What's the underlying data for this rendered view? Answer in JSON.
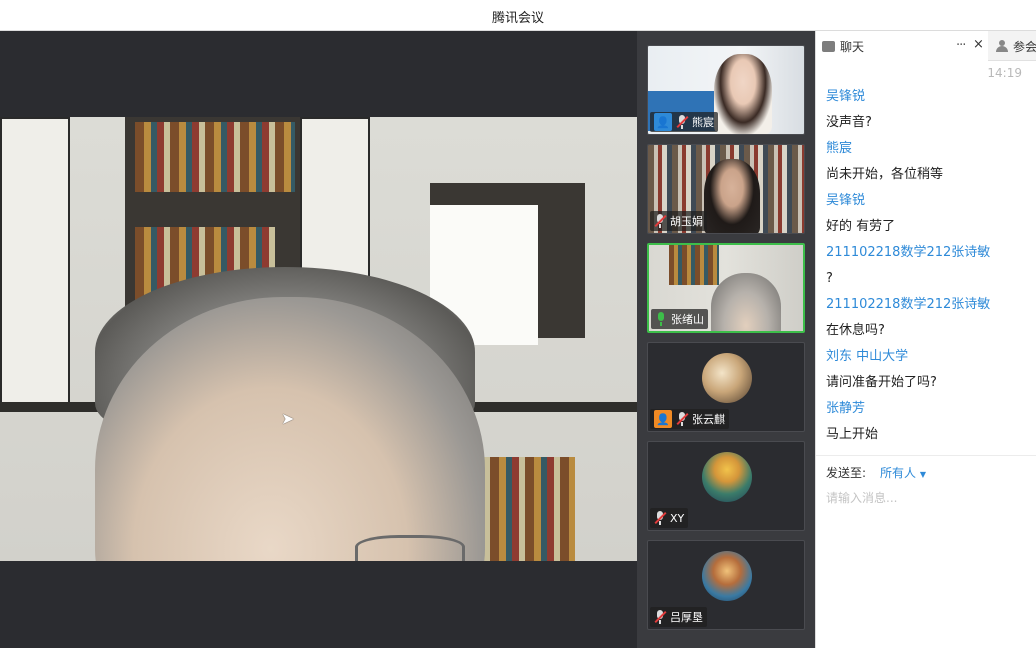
{
  "window": {
    "title": "腾讯会议"
  },
  "participants": [
    {
      "name": "熊宸",
      "mic": "muted",
      "has_user_icon": true,
      "user_icon_color": "#2e8ad8"
    },
    {
      "name": "胡玉娟",
      "mic": "muted",
      "has_user_icon": false
    },
    {
      "name": "张绪山",
      "mic": "on",
      "has_user_icon": false,
      "speaking": true
    },
    {
      "name": "张云麒",
      "mic": "muted",
      "has_user_icon": true,
      "user_icon_color": "#f08a24"
    },
    {
      "name": "XY",
      "mic": "muted",
      "has_user_icon": false
    },
    {
      "name": "吕厚垦",
      "mic": "muted",
      "has_user_icon": false
    }
  ],
  "chat": {
    "tab_label": "聊天",
    "tab_more": "···",
    "tab_close": "×",
    "participants_tab_label": "参会",
    "timestamp": "14:19",
    "messages": [
      {
        "sender": "吴锋锐",
        "text": "没声音?"
      },
      {
        "sender": "熊宸",
        "text": "尚未开始，各位稍等"
      },
      {
        "sender": "吴锋锐",
        "text": "好的 有劳了"
      },
      {
        "sender": "211102218数学212张诗敏",
        "text": "?"
      },
      {
        "sender": "211102218数学212张诗敏",
        "text": "在休息吗?"
      },
      {
        "sender": "刘东 中山大学",
        "text": "请问准备开始了吗?"
      },
      {
        "sender": "张静芳",
        "text": "马上开始"
      }
    ],
    "send_to_label": "发送至:",
    "send_to_target": "所有人",
    "input_placeholder": "请输入消息..."
  },
  "colors": {
    "accent": "#2e8ad8",
    "speaking_border": "#3dbe4a",
    "muted": "#e23b3b"
  }
}
